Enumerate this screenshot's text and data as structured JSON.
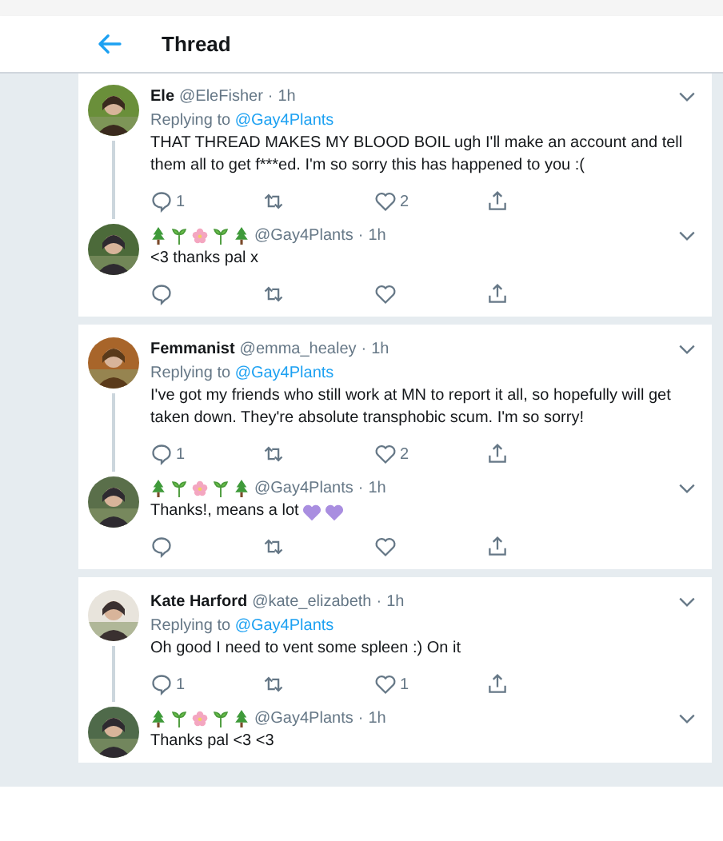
{
  "header": {
    "title": "Thread"
  },
  "groups": [
    {
      "tweets": [
        {
          "kind": "text",
          "name": "Ele",
          "handle": "@EleFisher",
          "separator": "·",
          "time": "1h",
          "reply_prefix": "Replying to",
          "reply_to": "@Gay4Plants",
          "text": "THAT THREAD MAKES MY BLOOD BOIL ugh I'll make an account and tell them all to get f***ed. I'm so sorry this has happened to you :(",
          "hearts_suffix": false,
          "actions": true,
          "replies": "1",
          "likes": "2"
        },
        {
          "kind": "emoji",
          "handle": "@Gay4Plants",
          "separator": "·",
          "time": "1h",
          "text": "<3 thanks pal x",
          "hearts_suffix": false,
          "actions": true
        }
      ]
    },
    {
      "tweets": [
        {
          "kind": "text",
          "name": "Femmanist",
          "handle": "@emma_healey",
          "separator": "·",
          "time": "1h",
          "reply_prefix": "Replying to",
          "reply_to": "@Gay4Plants",
          "text": "I've got my friends who still work at MN to report it all, so hopefully will get taken down. They're absolute transphobic scum. I'm so sorry!",
          "hearts_suffix": false,
          "actions": true,
          "replies": "1",
          "likes": "2"
        },
        {
          "kind": "emoji",
          "handle": "@Gay4Plants",
          "separator": "·",
          "time": "1h",
          "text": "Thanks!, means a lot",
          "hearts_suffix": true,
          "actions": true
        }
      ]
    },
    {
      "tweets": [
        {
          "kind": "text",
          "name": "Kate Harford",
          "handle": "@kate_elizabeth",
          "separator": "·",
          "time": "1h",
          "reply_prefix": "Replying to",
          "reply_to": "@Gay4Plants",
          "text": "Oh good I need to vent some spleen :) On it",
          "hearts_suffix": false,
          "actions": true,
          "replies": "1",
          "likes": "1"
        },
        {
          "kind": "emoji",
          "handle": "@Gay4Plants",
          "separator": "·",
          "time": "1h",
          "text": "Thanks pal <3 <3",
          "hearts_suffix": false,
          "actions": false
        }
      ]
    }
  ]
}
